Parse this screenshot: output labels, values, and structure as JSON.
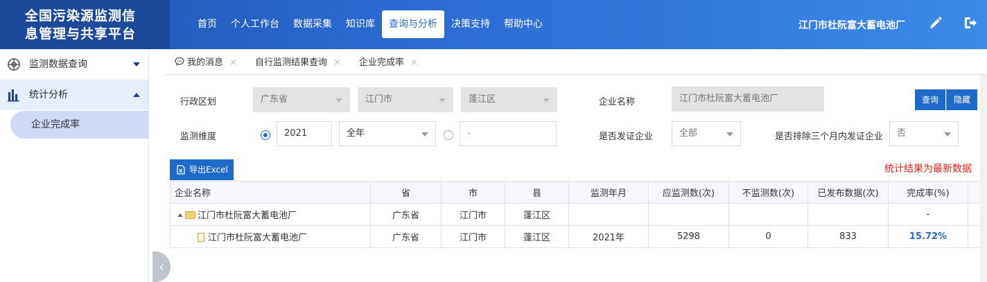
{
  "header": {
    "title_line1": "全国污染源监测信",
    "title_line2": "息管理与共享平台",
    "nav": [
      "首页",
      "个人工作台",
      "数据采集",
      "知识库",
      "查询与分析",
      "决策支持",
      "帮助中心"
    ],
    "active_nav": "查询与分析",
    "company": "江门市杜阮富大蓄电池厂",
    "edit_icon": "pencil-icon",
    "logout_icon": "logout-icon"
  },
  "sidebar": {
    "items": [
      {
        "label": "监测数据查询",
        "icon": "target-icon"
      },
      {
        "label": "统计分析",
        "icon": "bar-chart-icon"
      }
    ],
    "sub_items": [
      "企业完成率"
    ]
  },
  "tabs": [
    {
      "label": "我的消息",
      "icon": "message-icon",
      "close": "×"
    },
    {
      "label": "自行监测结果查询",
      "close": "×"
    },
    {
      "label": "企业完成率",
      "close": "×"
    }
  ],
  "form": {
    "region_label": "行政区划",
    "province": "广东省",
    "city": "江门市",
    "county": "蓬江区",
    "company_label": "企业名称",
    "company_value": "江门市杜阮富大蓄电池厂",
    "query_button": "查询",
    "hide_button": "隐藏",
    "dimension_label": "监测维度",
    "year": "2021",
    "period": "全年",
    "range_placeholder": "-",
    "cert_label": "是否发证企业",
    "cert_value": "全部",
    "exclude_label": "是否排除三个月内发证企业",
    "exclude_value": "否"
  },
  "export_button": "导出Excel",
  "notice": "统计结果为最新数据",
  "table": {
    "columns": [
      "企业名称",
      "省",
      "市",
      "县",
      "监测年月",
      "应监测数(次)",
      "不监测数(次)",
      "已发布数据(次)",
      "完成率(%)"
    ],
    "rows": [
      {
        "name": "江门市杜阮富大蓄电池厂",
        "province": "广东省",
        "city": "江门市",
        "county": "蓬江区",
        "month": "",
        "expected": "",
        "not_monitored": "",
        "published": "",
        "rate": "-"
      },
      {
        "name": "江门市杜阮富大蓄电池厂",
        "province": "广东省",
        "city": "江门市",
        "county": "蓬江区",
        "month": "2021年",
        "expected": "5298",
        "not_monitored": "0",
        "published": "833",
        "rate": "15.72%"
      }
    ]
  },
  "collapse_handle": "‹"
}
